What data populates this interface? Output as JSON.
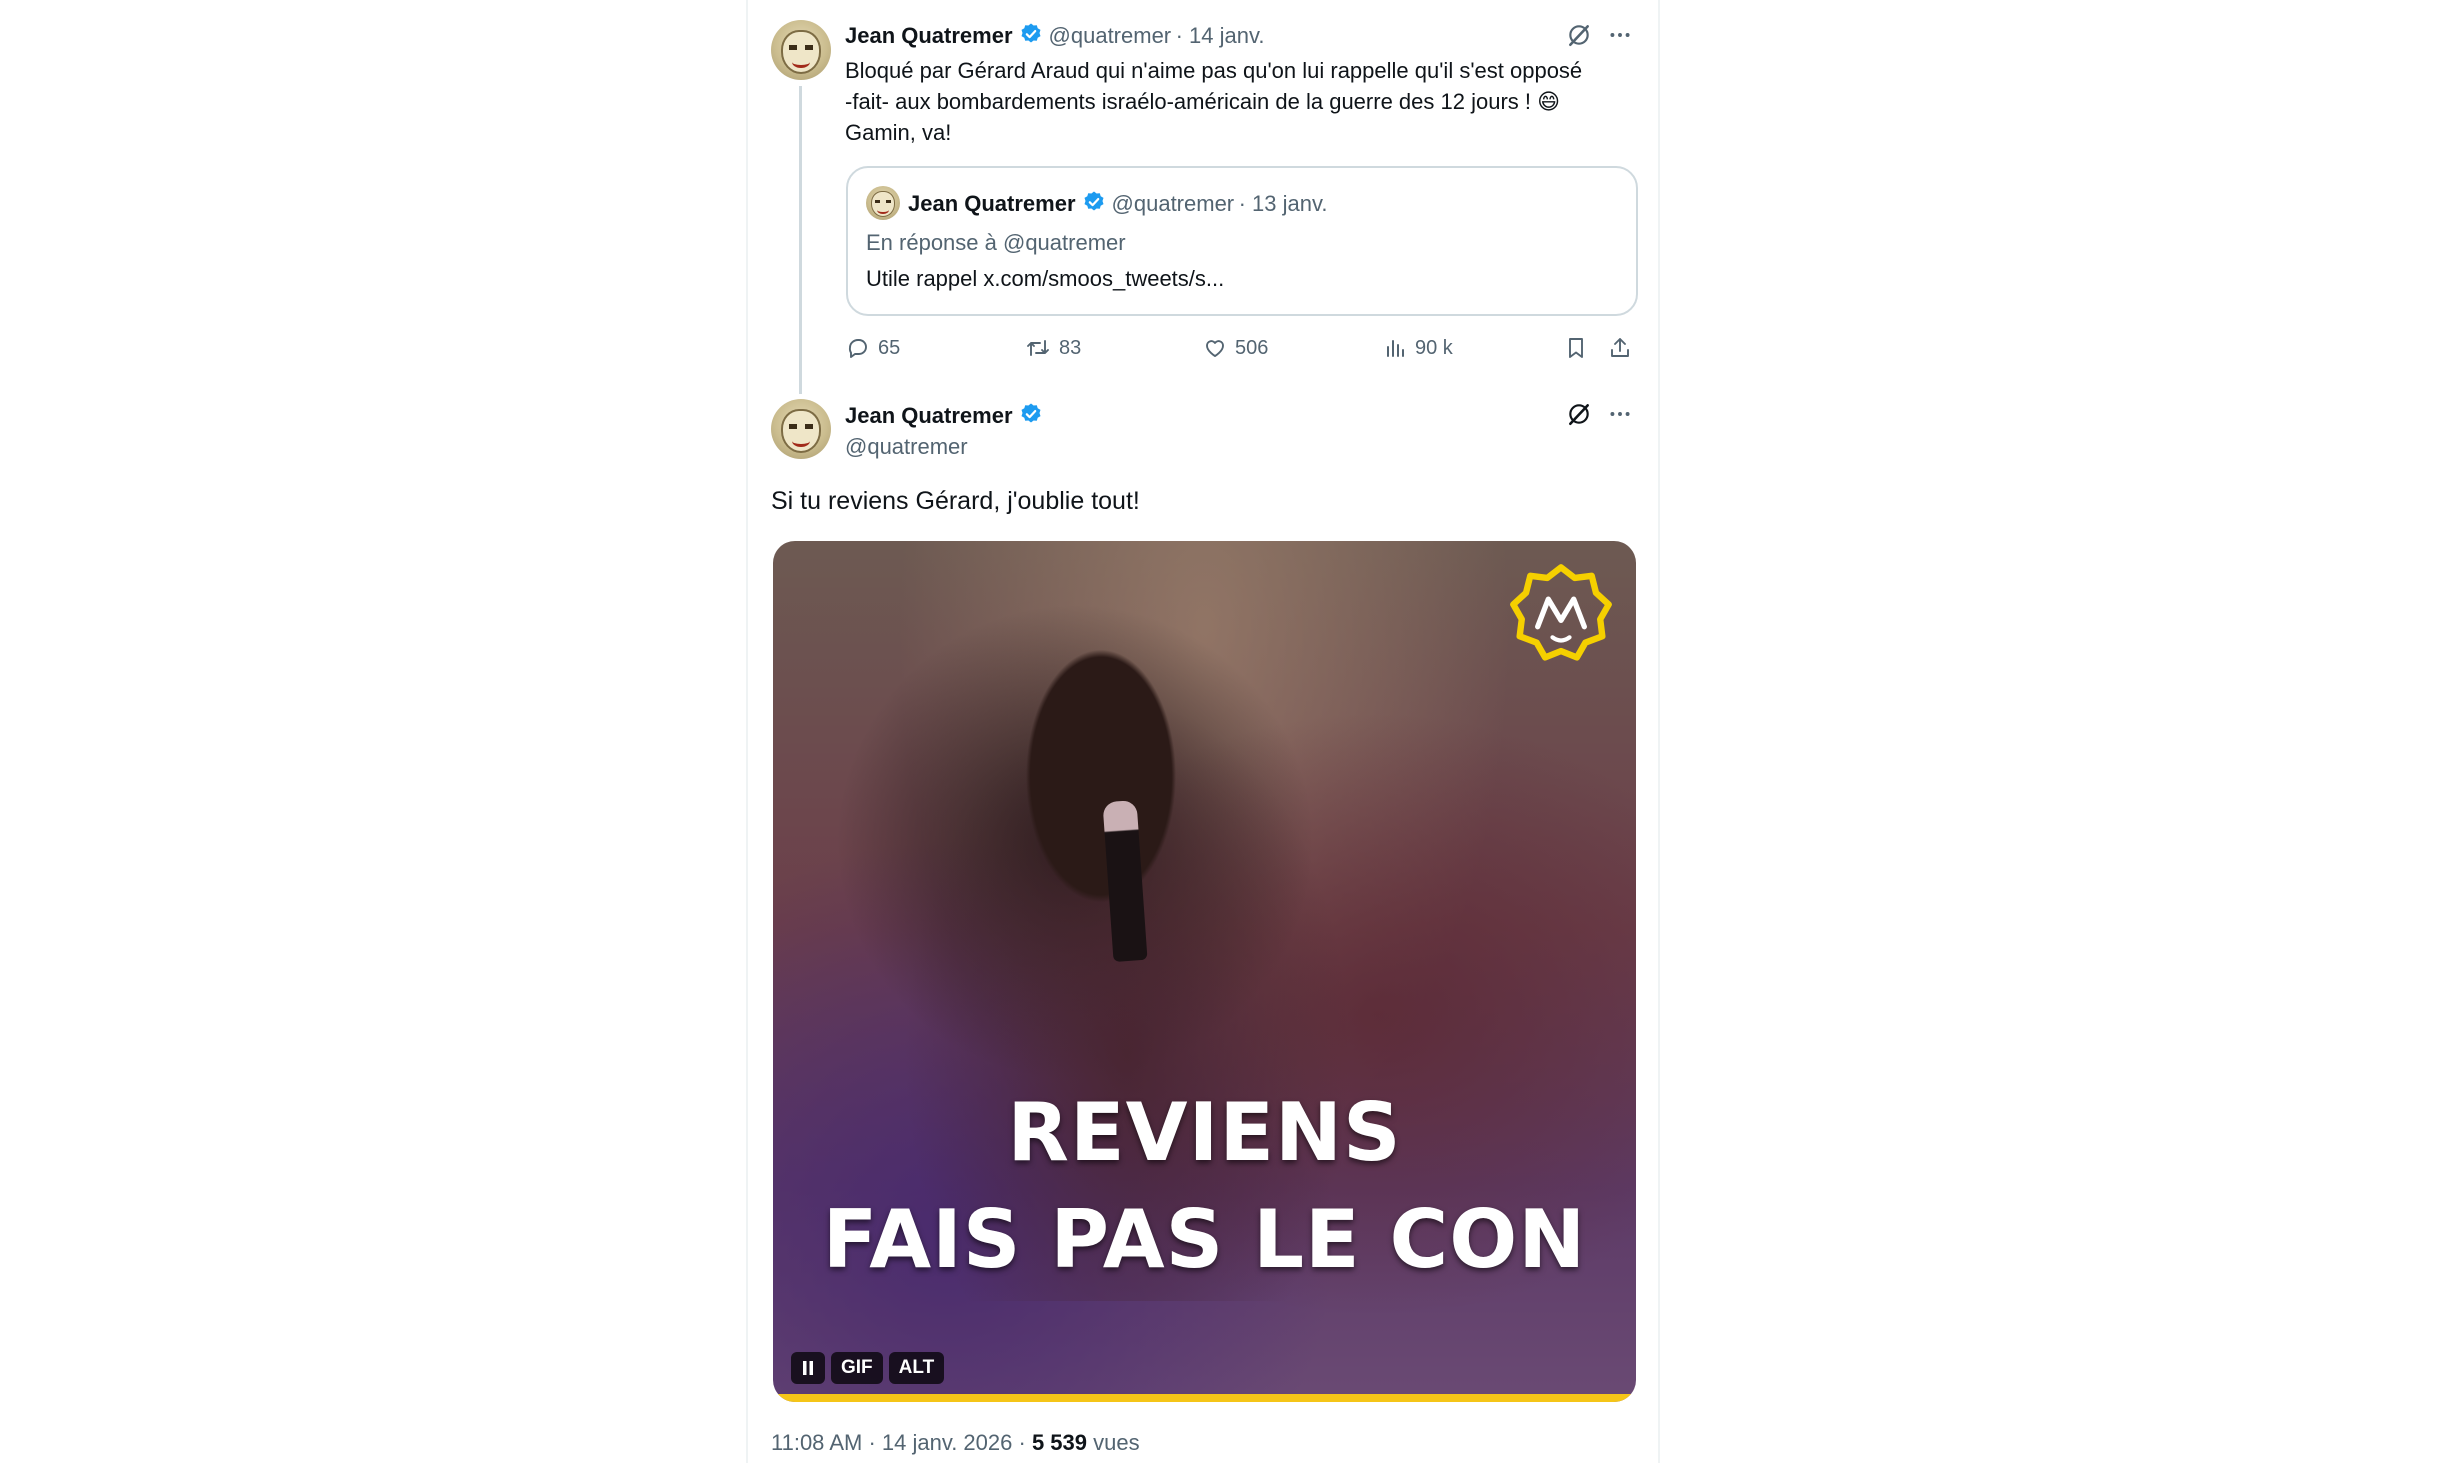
{
  "tweet1": {
    "author_name": "Jean Quatremer",
    "handle": "@quatremer",
    "date": "· 14 janv.",
    "text_lines": [
      "Bloqué par Gérard Araud qui n'aime pas qu'on lui rappelle qu'il s'est opposé",
      "-fait- aux bombardements israélo-américain de la guerre des 12 jours ! 😄",
      "Gamin, va!"
    ],
    "quote": {
      "author_name": "Jean Quatremer",
      "handle": "@quatremer",
      "date": "· 13 janv.",
      "reply_to": "En réponse à @quatremer",
      "text": "Utile rappel x.com/smoos_tweets/s..."
    },
    "stats": {
      "replies": "65",
      "reposts": "83",
      "likes": "506",
      "views": "90 k"
    }
  },
  "tweet2": {
    "author_name": "Jean Quatremer",
    "handle": "@quatremer",
    "text": "Si tu reviens Gérard, j'oublie tout!",
    "media": {
      "caption_line1": "REVIENS",
      "caption_line2": "FAIS PAS LE CON",
      "gif_badge": "GIF",
      "alt_badge": "ALT",
      "progress_fraction": 1.0
    },
    "footer": {
      "time": "11:08 AM",
      "date": "· 14 janv. 2026 ·",
      "views_count": "5 539",
      "views_label": "vues"
    }
  },
  "colors": {
    "accent_blue": "#1d9bf0",
    "text_secondary": "#536471",
    "border": "#cfd9de",
    "gif_progress": "#f5c518"
  },
  "icons": {
    "verified": "verified-badge-icon",
    "grok": "grok-icon",
    "more": "more-dots-icon",
    "reply": "reply-icon",
    "repost": "repost-icon",
    "like": "heart-icon",
    "views": "views-chart-icon",
    "bookmark": "bookmark-icon",
    "share": "share-icon",
    "pause": "pause-icon"
  }
}
